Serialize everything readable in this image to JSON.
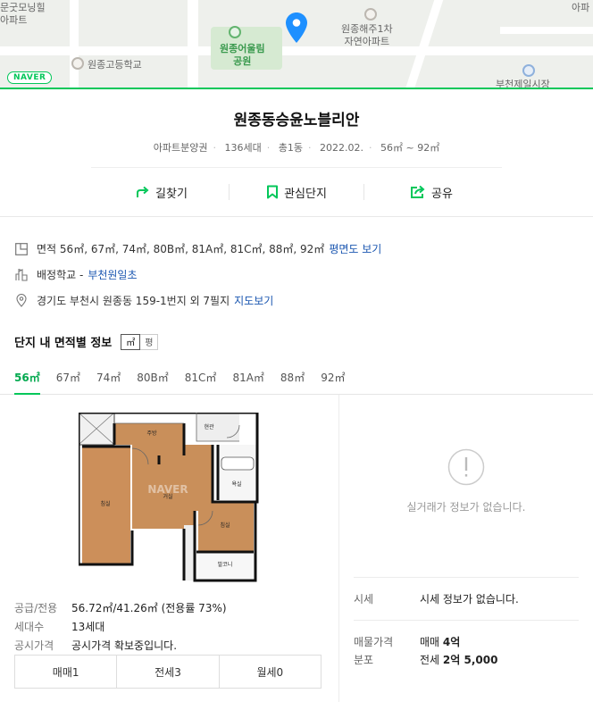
{
  "map": {
    "labels": {
      "apt_tl": "문굿모닝힐\n아파트",
      "school": "원종고등학교",
      "park": "원종어울림\n공원",
      "apt_tr": "원종해주1차\n자연아파트",
      "apt_far_tr": "아파",
      "market": "부천제일시장"
    },
    "logo": "NAVER",
    "pin_color": "#1e90ff",
    "accent": "#03c75a"
  },
  "complex": {
    "name": "원종동승윤노블리안",
    "meta": [
      "아파트분양권",
      "136세대",
      "총1동",
      "2022.02.",
      "56㎡ ~ 92㎡"
    ]
  },
  "actions": {
    "directions": "길찾기",
    "favorite": "관심단지",
    "share": "공유"
  },
  "info": {
    "area_label": "면적",
    "area_values": "56㎡, 67㎡, 74㎡, 80B㎡, 81A㎡, 81C㎡, 88㎡, 92㎡",
    "area_link": "평면도 보기",
    "school_label": "배정학교 -",
    "school_link": "부천원일초",
    "address": "경기도 부천시 원종동 159-1번지 외 7필지",
    "address_link": "지도보기"
  },
  "area_section": {
    "title": "단지 내 면적별 정보",
    "unit_sqm": "㎡",
    "unit_pyeong": "평",
    "tabs": [
      "56㎡",
      "67㎡",
      "74㎡",
      "80B㎡",
      "81C㎡",
      "81A㎡",
      "88㎡",
      "92㎡"
    ],
    "active_tab": 0
  },
  "floorplan": {
    "rooms": {
      "kitchen": "주방",
      "entrance": "현관",
      "room_left": "침실",
      "living": "거실",
      "bath": "욕실",
      "room_right": "침실",
      "balcony": "발코니"
    },
    "watermark": "NAVER"
  },
  "specs": [
    {
      "k": "공급/전용",
      "v": "56.72㎡/41.26㎡ (전용률 73%)"
    },
    {
      "k": "세대수",
      "v": "13세대"
    },
    {
      "k": "공시가격",
      "v": "공시가격 확보중입니다."
    }
  ],
  "trade_tabs": [
    "매매1",
    "전세3",
    "월세0"
  ],
  "transactions": {
    "empty_text": "실거래가 정보가 없습니다.",
    "market_label": "시세",
    "market_value": "시세 정보가 없습니다.",
    "listing_label": "매물가격\n분포",
    "sale_prefix": "매매",
    "sale_value": "4억",
    "jeonse_prefix": "전세",
    "jeonse_value": "2억 5,000"
  }
}
